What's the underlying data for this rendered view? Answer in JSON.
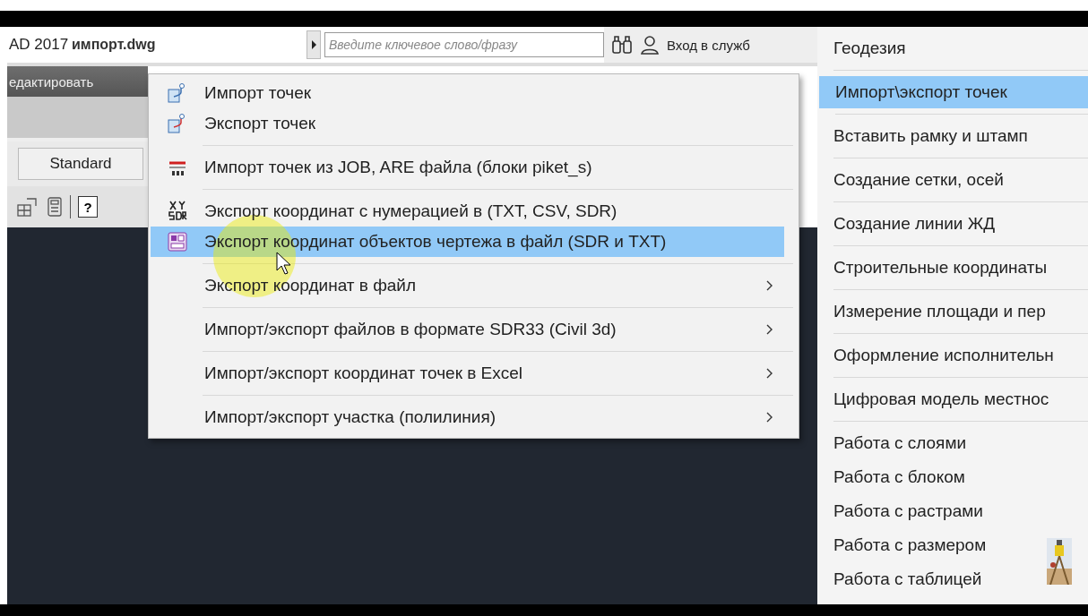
{
  "title_bar": {
    "app": "AD 2017",
    "file": "импорт.dwg",
    "search": {
      "placeholder": "Введите ключевое слово/фразу"
    },
    "sign_in": "Вход в служб"
  },
  "ribbon": {
    "tab": "едактировать",
    "style_combo": "Standard",
    "help_button": "?"
  },
  "menu": {
    "items": [
      {
        "label": "Импорт точек",
        "kind": "points-in",
        "submenu": false,
        "selected": false,
        "divider": false
      },
      {
        "label": "Экспорт точек",
        "kind": "points-out",
        "submenu": false,
        "selected": false,
        "divider": true
      },
      {
        "label": "Импорт точек из JOB, ARE файла (блоки piket_s)",
        "kind": "job",
        "submenu": false,
        "selected": false,
        "divider": true
      },
      {
        "label": "Экспорт координат с нумерацией в (TXT, CSV, SDR)",
        "kind": "xy-sdr",
        "submenu": false,
        "selected": false,
        "divider": false
      },
      {
        "label": "Экспорт координат объектов чертежа в файл (SDR и TXT)",
        "kind": "sdr-file",
        "submenu": false,
        "selected": true,
        "divider": true
      },
      {
        "label": "Экспорт координат в файл",
        "kind": "plain",
        "submenu": true,
        "selected": false,
        "divider": true
      },
      {
        "label": "Импорт/экспорт файлов в формате SDR33 (Civil 3d)",
        "kind": "plain",
        "submenu": true,
        "selected": false,
        "divider": true
      },
      {
        "label": "Импорт/экспорт координат точек в Excel",
        "kind": "plain",
        "submenu": true,
        "selected": false,
        "divider": true
      },
      {
        "label": "Импорт/экспорт участка (полилиния)",
        "kind": "plain",
        "submenu": true,
        "selected": false,
        "divider": false
      }
    ]
  },
  "side_menu": {
    "items": [
      {
        "label": "Геодезия",
        "selected": false,
        "divider": true
      },
      {
        "label": "Импорт\\экспорт точек",
        "selected": true,
        "divider": true
      },
      {
        "label": "Вставить рамку и штамп",
        "selected": false,
        "divider": true
      },
      {
        "label": "Создание сетки, осей",
        "selected": false,
        "divider": true
      },
      {
        "label": "Создание линии ЖД",
        "selected": false,
        "divider": true
      },
      {
        "label": "Строительные координаты",
        "selected": false,
        "divider": true
      },
      {
        "label": "Измерение площади и пер",
        "selected": false,
        "divider": true
      },
      {
        "label": "Оформление исполнительн",
        "selected": false,
        "divider": true
      },
      {
        "label": "Цифровая модель местнос",
        "selected": false,
        "divider": true
      },
      {
        "label": "Работа с слоями",
        "selected": false,
        "divider": false
      },
      {
        "label": "Работа с блоком",
        "selected": false,
        "divider": false
      },
      {
        "label": "Работа с растрами",
        "selected": false,
        "divider": false
      },
      {
        "label": "Работа с размером",
        "selected": false,
        "divider": false
      },
      {
        "label": "Работа с таблицей",
        "selected": false,
        "divider": false
      }
    ]
  }
}
